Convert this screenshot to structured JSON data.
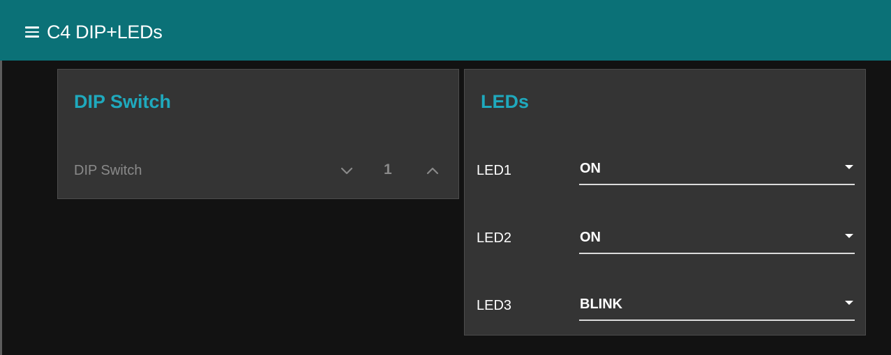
{
  "app_bar": {
    "title": "C4 DIP+LEDs",
    "menu_icon": "hamburger-menu-icon",
    "background": "#0b7177"
  },
  "dip_card": {
    "title": "DIP Switch",
    "stepper": {
      "label": "DIP Switch",
      "value": "1",
      "decrement_icon": "chevron-down-icon",
      "increment_icon": "chevron-up-icon"
    }
  },
  "leds_card": {
    "title": "LEDs",
    "leds": [
      {
        "label": "LED1",
        "value": "ON"
      },
      {
        "label": "LED2",
        "value": "ON"
      },
      {
        "label": "LED3",
        "value": "BLINK"
      }
    ]
  },
  "colors": {
    "accent": "#1fa9bd",
    "card_bg": "#343434",
    "page_bg": "#121212"
  }
}
